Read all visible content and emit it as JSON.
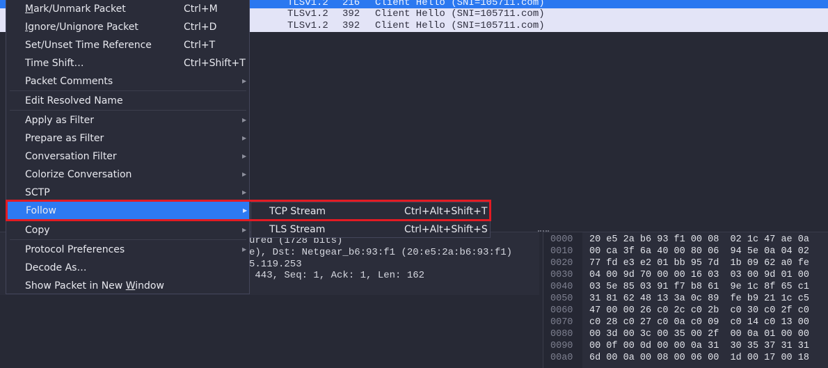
{
  "packet_list": {
    "rows": [
      {
        "protocol": "TLSv1.2",
        "length": "216",
        "info": "Client Hello (SNI=105711.com)",
        "selected": true
      },
      {
        "protocol": "TLSv1.2",
        "length": "392",
        "info": "Client Hello (SNI=105711.com)",
        "selected": false
      },
      {
        "protocol": "TLSv1.2",
        "length": "392",
        "info": "Client Hello (SNI=105711.com)",
        "selected": false
      }
    ]
  },
  "details": {
    "lines": [
      "ured (1728 bits)",
      "e), Dst: Netgear_b6:93:f1 (20:e5:2a:b6:93:f1)",
      "5.119.253",
      " 443, Seq: 1, Ack: 1, Len: 162"
    ]
  },
  "hex": {
    "rows": [
      {
        "offset": "0000",
        "bytes": "20 e5 2a b6 93 f1 00 08  02 1c 47 ae 0a"
      },
      {
        "offset": "0010",
        "bytes": "00 ca 3f 6a 40 00 80 06  94 5e 0a 04 02"
      },
      {
        "offset": "0020",
        "bytes": "77 fd e3 e2 01 bb 95 7d  1b 09 62 a0 fe"
      },
      {
        "offset": "0030",
        "bytes": "04 00 9d 70 00 00 16 03  03 00 9d 01 00"
      },
      {
        "offset": "0040",
        "bytes": "03 5e 85 03 91 f7 b8 61  9e 1c 8f 65 c1"
      },
      {
        "offset": "0050",
        "bytes": "31 81 62 48 13 3a 0c 89  fe b9 21 1c c5"
      },
      {
        "offset": "0060",
        "bytes": "47 00 00 26 c0 2c c0 2b  c0 30 c0 2f c0"
      },
      {
        "offset": "0070",
        "bytes": "c0 28 c0 27 c0 0a c0 09  c0 14 c0 13 00"
      },
      {
        "offset": "0080",
        "bytes": "00 3d 00 3c 00 35 00 2f  00 0a 01 00 00"
      },
      {
        "offset": "0090",
        "bytes": "00 0f 00 0d 00 00 0a 31  30 35 37 31 31"
      },
      {
        "offset": "00a0",
        "bytes": "6d 00 0a 00 08 00 06 00  1d 00 17 00 18"
      }
    ]
  },
  "context_menu": {
    "items": [
      {
        "label_pre": "",
        "mnemonic": "M",
        "label_post": "ark/Unmark Packet",
        "shortcut": "Ctrl+M"
      },
      {
        "label_pre": "",
        "mnemonic": "I",
        "label_post": "gnore/Unignore Packet",
        "shortcut": "Ctrl+D"
      },
      {
        "label_pre": "Set/Unset Time Reference",
        "mnemonic": "",
        "label_post": "",
        "shortcut": "Ctrl+T"
      },
      {
        "label_pre": "Time Shift…",
        "mnemonic": "",
        "label_post": "",
        "shortcut": "Ctrl+Shift+T"
      },
      {
        "label_pre": "Packet Comments",
        "mnemonic": "",
        "label_post": "",
        "shortcut": ""
      },
      {
        "label_pre": "Edit Resolved Name",
        "mnemonic": "",
        "label_post": "",
        "shortcut": ""
      },
      {
        "label_pre": "Apply as Filter",
        "mnemonic": "",
        "label_post": "",
        "shortcut": ""
      },
      {
        "label_pre": "Prepare as Filter",
        "mnemonic": "",
        "label_post": "",
        "shortcut": ""
      },
      {
        "label_pre": "Conversation Filter",
        "mnemonic": "",
        "label_post": "",
        "shortcut": ""
      },
      {
        "label_pre": "Colorize Conversation",
        "mnemonic": "",
        "label_post": "",
        "shortcut": ""
      },
      {
        "label_pre": "SCTP",
        "mnemonic": "",
        "label_post": "",
        "shortcut": ""
      },
      {
        "label_pre": "Follow",
        "mnemonic": "",
        "label_post": "",
        "shortcut": ""
      },
      {
        "label_pre": "Copy",
        "mnemonic": "",
        "label_post": "",
        "shortcut": ""
      },
      {
        "label_pre": "Protocol Preferences",
        "mnemonic": "",
        "label_post": "",
        "shortcut": ""
      },
      {
        "label_pre": "Decode As…",
        "mnemonic": "",
        "label_post": "",
        "shortcut": ""
      },
      {
        "label_pre": "Show Packet in New ",
        "mnemonic": "W",
        "label_post": "indow",
        "shortcut": ""
      }
    ],
    "submenu_arrow": "▶"
  },
  "follow_submenu": {
    "items": [
      {
        "label": "TCP Stream",
        "shortcut": "Ctrl+Alt+Shift+T"
      },
      {
        "label": "TLS Stream",
        "shortcut": "Ctrl+Alt+Shift+S"
      }
    ]
  },
  "colors": {
    "selection": "#2b78f0",
    "highlight_box": "#e31b23",
    "menu_bg": "#2a2c39"
  }
}
